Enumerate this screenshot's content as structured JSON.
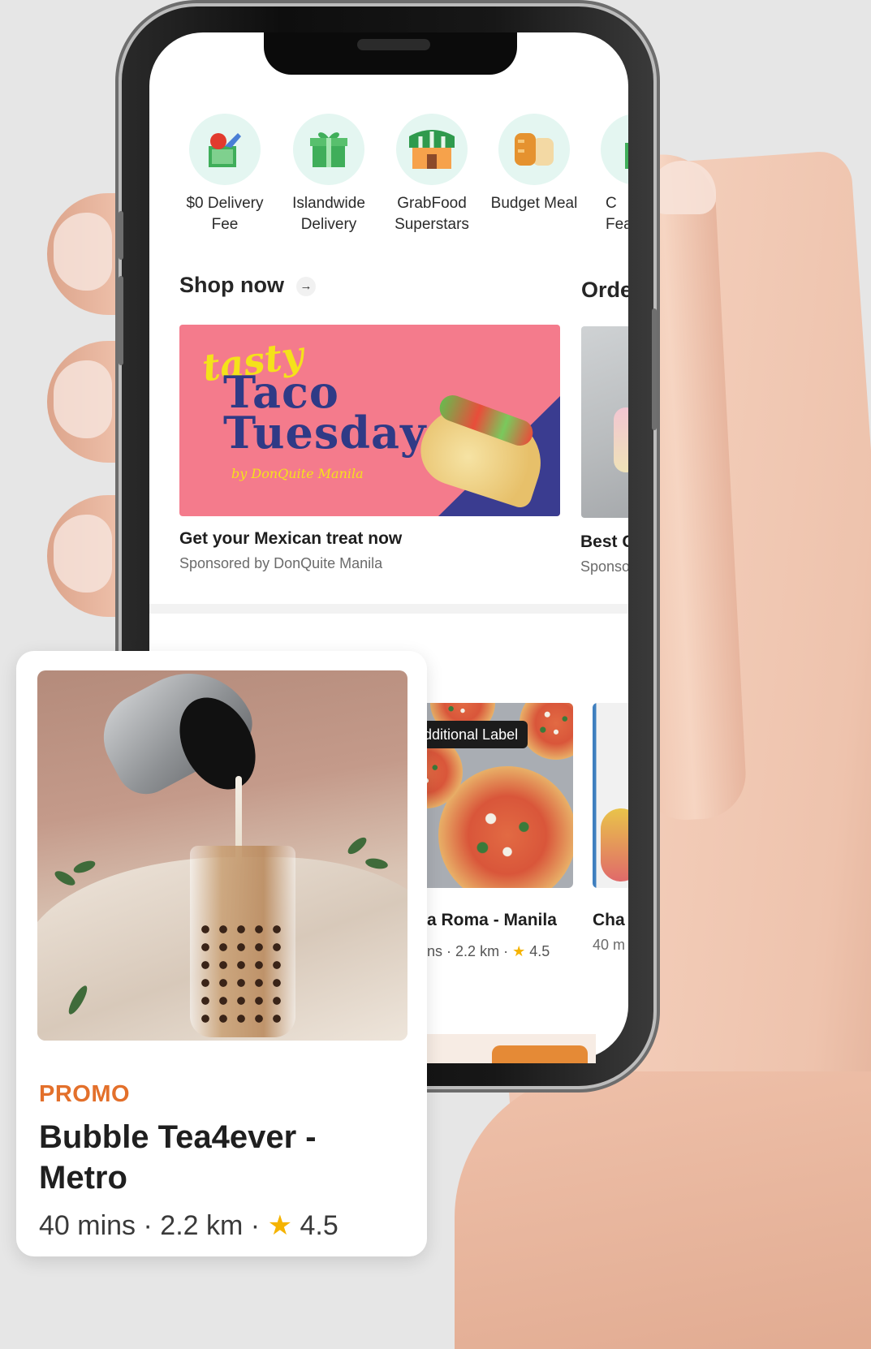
{
  "categories": [
    {
      "label": "$0 Delivery\nFee",
      "icon": "grocery-bag-icon"
    },
    {
      "label": "Islandwide\nDelivery",
      "icon": "gift-icon"
    },
    {
      "label": "GrabFood\nSuperstars",
      "icon": "storefront-icon"
    },
    {
      "label": "Budget Meal",
      "icon": "bread-icon"
    },
    {
      "label": "C\nFea",
      "icon": "drink-icon"
    }
  ],
  "shop_now": {
    "title": "Shop now",
    "arrow": "→",
    "banner": {
      "tasty": "tasty",
      "line1": "Taco",
      "line2": "Tuesday",
      "byline": "by DonQuite Manila"
    },
    "card_title": "Get your Mexican treat now",
    "card_sub": "Sponsored by DonQuite Manila"
  },
  "order_peek": {
    "title": "Orde",
    "card_title": "Best C",
    "card_sub": "Sponso"
  },
  "restaurants": [
    {
      "label": "dditional Label",
      "name": "a Roma - Manila",
      "meta_time": "ns",
      "meta_distance": "2.2 km",
      "rating": "4.5"
    },
    {
      "name": "Cha",
      "meta_time": "40 m"
    }
  ],
  "promo_card": {
    "tag": "PROMO",
    "name": "Bubble Tea4ever - Metro",
    "time": "40 mins",
    "distance": "2.2 km",
    "rating": "4.5",
    "separator": "·",
    "star": "★"
  },
  "colors": {
    "accent_orange": "#e3702b",
    "icon_circle": "#e4f6f1",
    "banner_pink": "#f47b8c",
    "banner_navy": "#2f3a86",
    "star": "#f5b300"
  }
}
